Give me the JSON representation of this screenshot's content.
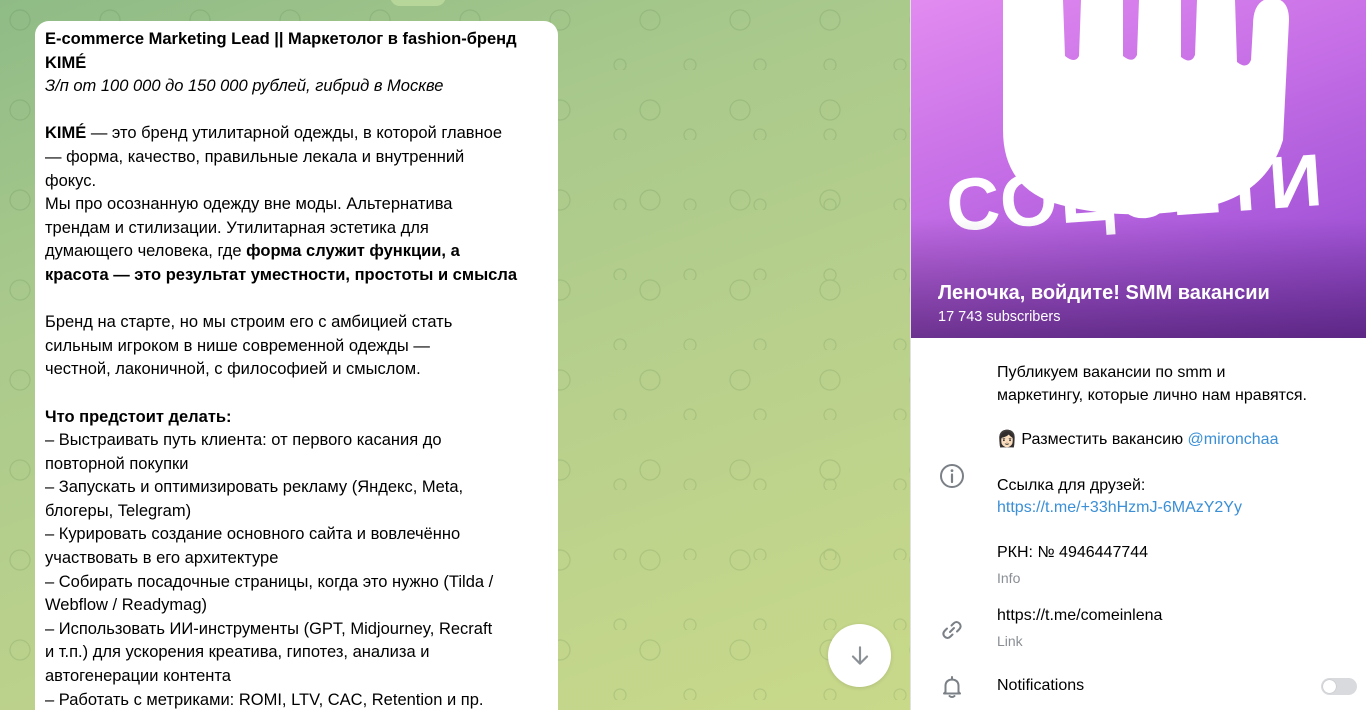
{
  "message": {
    "title_line1": "E-commerce Marketing Lead || Маркетолог в fashion-бренд",
    "title_line2": "KIMÉ",
    "subtitle": "З/п от 100 000 до 150 000 рублей, гибрид в Москве",
    "p1_brand": "KIMÉ",
    "p1_l1_rest": " — это бренд утилитарной одежды, в которой главное",
    "p1_l2": "— форма, качество, правильные лекала и внутренний",
    "p1_l3": "фокус.",
    "p1_l4": "Мы про осознанную одежду вне моды. Альтернатива",
    "p1_l5": "трендам и стилизации. Утилитарная эстетика для",
    "p1_l6_plain": "думающего человека, где ",
    "p1_l6_bold": "форма служит функции, а",
    "p1_l7_bold": "красота — это результат уместности, простоты и смысла",
    "p2_l1": "Бренд на старте, но мы строим его с амбицией стать",
    "p2_l2": "сильным игроком в нише современной одежды —",
    "p2_l3": "честной, лаконичной, с философией и смыслом.",
    "tasks_heading": "Что предстоит делать:",
    "tasks_lines": [
      "– Выстраивать путь клиента: от первого касания до",
      "повторной покупки",
      "– Запускать и оптимизировать рекламу (Яндекс, Meta,",
      "блогеры, Telegram)",
      "– Курировать создание основного сайта и вовлечённо",
      "участвовать в его архитектуре",
      "– Собирать посадочные страницы, когда это нужно (Tilda /",
      "Webflow / Readymag)",
      "– Использовать ИИ-инструменты (GPT, Midjourney, Recraft",
      "и т.п.) для ускорения креатива, гипотез, анализа и",
      "автогенерации контента",
      "– Работать с метриками: ROMI, LTV, CAC, Retention и пр."
    ]
  },
  "channel": {
    "cover_text": "СОЦСЕТИ",
    "name": "Леночка, войдите! SMM вакансии",
    "subscribers": "17 743 subscribers",
    "description_l1": "Публикуем вакансии по smm и",
    "description_l2": "маркетингу, которые лично нам нравятся.",
    "post_vacancy_emoji": "👩🏻",
    "post_vacancy_text": " Разместить вакансию ",
    "post_vacancy_handle": "@mironchaa",
    "friends_label": "Ссылка для друзей:",
    "friends_link": "https://t.me/+33hHzmJ-6MAzY2Yy",
    "rkn": "РКН: № 4946447744",
    "info_label": "Info",
    "channel_link": "https://t.me/comeinlena",
    "link_label": "Link",
    "notifications_label": "Notifications",
    "notifications_on": false
  },
  "colors": {
    "accent_link": "#3a8fd6",
    "secondary_text": "#8a8f94",
    "cover_purple": "#b461e0"
  }
}
